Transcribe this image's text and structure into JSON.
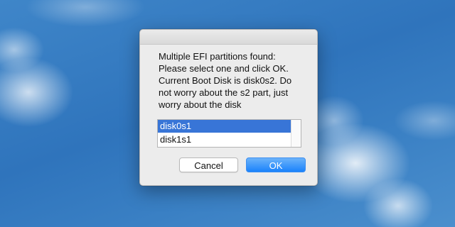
{
  "dialog": {
    "message_lines": [
      "Multiple EFI partitions found:",
      "Please select one and click OK.",
      "Current Boot Disk is disk0s2. Do",
      "not worry about the s2 part, just",
      "worry about the disk"
    ],
    "list": {
      "items": [
        {
          "label": "disk0s1",
          "selected": true
        },
        {
          "label": "disk1s1",
          "selected": false
        }
      ]
    },
    "buttons": {
      "cancel_label": "Cancel",
      "ok_label": "OK"
    }
  },
  "colors": {
    "accent": "#1a82fb",
    "selection": "#3875d7",
    "dialog_background": "#ececec"
  }
}
